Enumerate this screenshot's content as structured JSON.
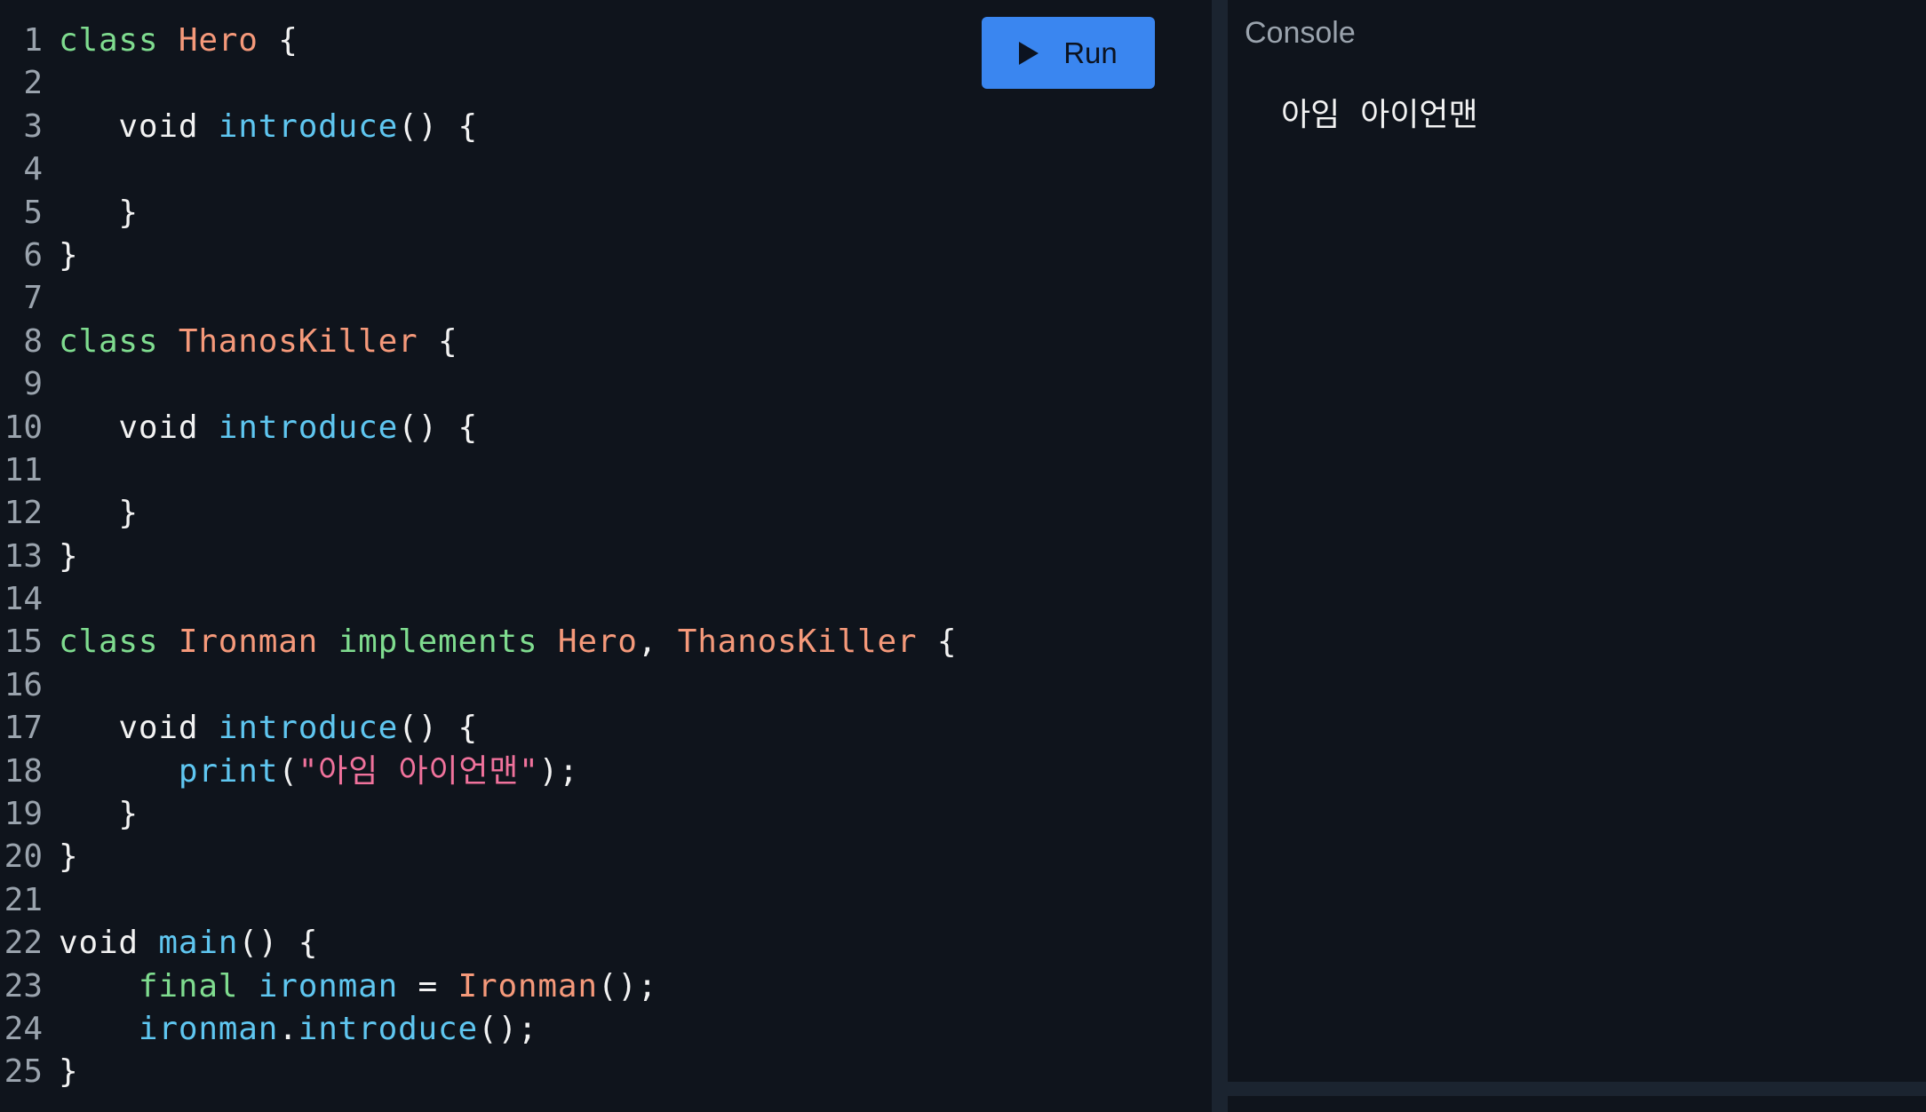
{
  "run_button": {
    "label": "Run",
    "icon": "play-icon",
    "color": "#3a86f0"
  },
  "console": {
    "title": "Console",
    "output": "아임  아이언맨"
  },
  "colors": {
    "background": "#0f141c",
    "keyword": "#7fdc8f",
    "class_name": "#f5997a",
    "function": "#5fc6f0",
    "string": "#f0729c",
    "plain": "#f2f2f2",
    "line_number": "#9aa3ad"
  },
  "code_lines": [
    [
      [
        "kw",
        "class "
      ],
      [
        "cls",
        "Hero"
      ],
      [
        "pl",
        " {"
      ]
    ],
    [],
    [
      [
        "pl",
        "   void "
      ],
      [
        "fn",
        "introduce"
      ],
      [
        "pl",
        "() {"
      ]
    ],
    [],
    [
      [
        "pl",
        "   }"
      ]
    ],
    [
      [
        "pl",
        "}"
      ]
    ],
    [],
    [
      [
        "kw",
        "class "
      ],
      [
        "cls",
        "ThanosKiller"
      ],
      [
        "pl",
        " {"
      ]
    ],
    [],
    [
      [
        "pl",
        "   void "
      ],
      [
        "fn",
        "introduce"
      ],
      [
        "pl",
        "() {"
      ]
    ],
    [],
    [
      [
        "pl",
        "   }"
      ]
    ],
    [
      [
        "pl",
        "}"
      ]
    ],
    [],
    [
      [
        "kw",
        "class "
      ],
      [
        "cls",
        "Ironman"
      ],
      [
        "kw",
        " implements "
      ],
      [
        "cls",
        "Hero"
      ],
      [
        "pl",
        ", "
      ],
      [
        "cls",
        "ThanosKiller"
      ],
      [
        "pl",
        " {"
      ]
    ],
    [],
    [
      [
        "pl",
        "   void "
      ],
      [
        "fn",
        "introduce"
      ],
      [
        "pl",
        "() {"
      ]
    ],
    [
      [
        "pl",
        "      "
      ],
      [
        "fn",
        "print"
      ],
      [
        "pl",
        "("
      ],
      [
        "str",
        "\"아임 아이언맨\""
      ],
      [
        "pl",
        ");"
      ]
    ],
    [
      [
        "pl",
        "   }"
      ]
    ],
    [
      [
        "pl",
        "}"
      ]
    ],
    [],
    [
      [
        "pl",
        "void "
      ],
      [
        "fn",
        "main"
      ],
      [
        "pl",
        "() {"
      ]
    ],
    [
      [
        "pl",
        "    "
      ],
      [
        "kw",
        "final "
      ],
      [
        "fn",
        "ironman"
      ],
      [
        "pl",
        " = "
      ],
      [
        "cls",
        "Ironman"
      ],
      [
        "pl",
        "();"
      ]
    ],
    [
      [
        "pl",
        "    "
      ],
      [
        "fn",
        "ironman"
      ],
      [
        "pl",
        "."
      ],
      [
        "fn",
        "introduce"
      ],
      [
        "pl",
        "();"
      ]
    ],
    [
      [
        "pl",
        "}"
      ]
    ]
  ]
}
